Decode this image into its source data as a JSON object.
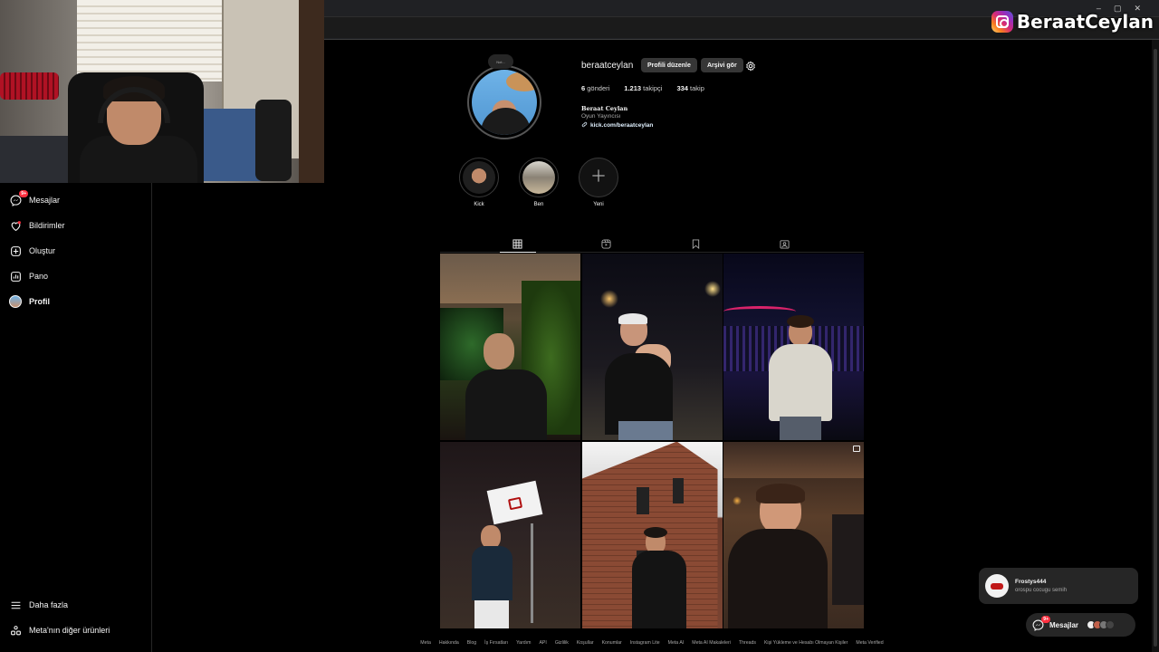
{
  "watermark": {
    "name": "BeraatCeylan",
    "icon": "instagram-icon"
  },
  "window_controls": [
    "–",
    "▢",
    "✕"
  ],
  "sidebar": {
    "items": [
      {
        "label": "Mesajlar",
        "icon": "messenger-icon",
        "badge": "9+"
      },
      {
        "label": "Bildirimler",
        "icon": "heart-icon"
      },
      {
        "label": "Oluştur",
        "icon": "plus-square-icon"
      },
      {
        "label": "Pano",
        "icon": "dashboard-icon"
      },
      {
        "label": "Profil",
        "icon": "profile-avatar-icon"
      }
    ],
    "bottom": [
      {
        "label": "Daha fazla",
        "icon": "hamburger-icon"
      },
      {
        "label": "Meta'nın diğer ürünleri",
        "icon": "meta-apps-icon"
      }
    ]
  },
  "profile": {
    "note": "Not...",
    "username": "beraatceylan",
    "edit_label": "Profili düzenle",
    "archive_label": "Arşivi gör",
    "stats": [
      {
        "value": "6",
        "label": "gönderi"
      },
      {
        "value": "1.213",
        "label": "takipçi"
      },
      {
        "value": "334",
        "label": "takip"
      }
    ],
    "display_name": "Beraat Ceylan",
    "category": "Oyun Yayıncısı",
    "link": "kick.com/beraatceylan"
  },
  "highlights": [
    {
      "label": "Kick"
    },
    {
      "label": "Ben"
    },
    {
      "label": "Yeni"
    }
  ],
  "tabs": [
    "posts-grid-icon",
    "reels-icon",
    "saved-icon",
    "tagged-icon"
  ],
  "footer_links": [
    "Meta",
    "Hakkında",
    "Blog",
    "İş Fırsatları",
    "Yardım",
    "API",
    "Gizlilik",
    "Koşullar",
    "Konumlar",
    "Instagram Lite",
    "Meta AI",
    "Meta AI Makaleleri",
    "Threads",
    "Kişi Yükleme ve Hesabı Olmayan Kişiler",
    "Meta Verified"
  ],
  "toast": {
    "user": "Frostys444",
    "message": "orospu cocugu semih"
  },
  "messages_pill": {
    "label": "Mesajlar",
    "badge": "9+"
  }
}
